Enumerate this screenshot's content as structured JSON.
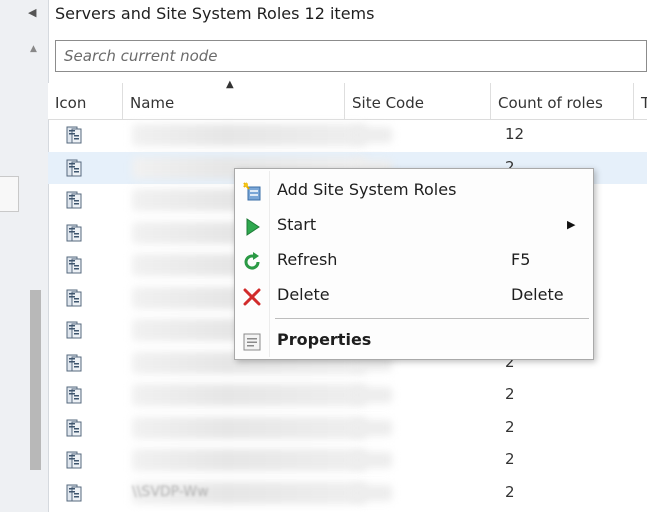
{
  "window": {
    "title": "Servers and Site System Roles 12 items"
  },
  "search": {
    "placeholder": "Search current node"
  },
  "columns": [
    "Icon",
    "Name",
    "Site Code",
    "Count of roles",
    "T"
  ],
  "rows": [
    {
      "count": "12"
    },
    {
      "count": "2"
    },
    {
      "count": ""
    },
    {
      "count": ""
    },
    {
      "count": ""
    },
    {
      "count": ""
    },
    {
      "count": ""
    },
    {
      "count": "2"
    },
    {
      "count": "2"
    },
    {
      "count": "2"
    },
    {
      "count": "2"
    },
    {
      "count": "2",
      "name": "\\\\SVDP-Ww"
    }
  ],
  "context_menu": {
    "items": [
      {
        "label": "Add Site System Roles",
        "shortcut": "",
        "icon": "add-roles-icon"
      },
      {
        "label": "Start",
        "shortcut": "",
        "icon": "start-icon",
        "submenu": true
      },
      {
        "label": "Refresh",
        "shortcut": "F5",
        "icon": "refresh-icon"
      },
      {
        "label": "Delete",
        "shortcut": "Delete",
        "icon": "delete-icon"
      },
      {
        "label": "Properties",
        "shortcut": "",
        "icon": "properties-icon",
        "bold": true
      }
    ]
  },
  "colors": {
    "selected_row": "#e6f0fa",
    "start_green": "#2fa84f",
    "delete_red": "#d12b2b"
  }
}
